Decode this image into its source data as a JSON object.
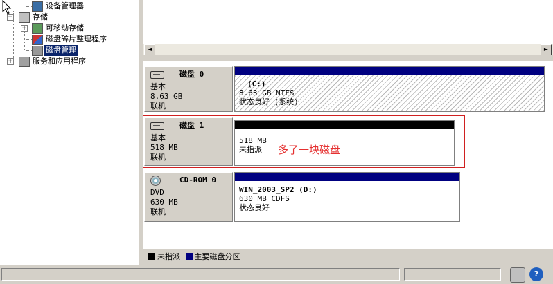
{
  "tree": {
    "items": [
      {
        "label": "设备管理器",
        "expander": ""
      },
      {
        "label": "存储",
        "expander": "−"
      },
      {
        "label": "可移动存储",
        "expander": "+"
      },
      {
        "label": "磁盘碎片整理程序",
        "expander": ""
      },
      {
        "label": "磁盘管理",
        "expander": ""
      },
      {
        "label": "服务和应用程序",
        "expander": "+"
      }
    ]
  },
  "scroll": {
    "left_arrow": "◄",
    "right_arrow": "►"
  },
  "disks": [
    {
      "name": "磁盘 0",
      "type": "基本",
      "size": "8.63 GB",
      "status": "联机",
      "partition": {
        "label": "(C:)",
        "detail": "8.63 GB NTFS",
        "state": "状态良好 (系统)"
      }
    },
    {
      "name": "磁盘 1",
      "type": "基本",
      "size": "518 MB",
      "status": "联机",
      "partition": {
        "label": "",
        "detail": "518 MB",
        "state": "未指派"
      }
    },
    {
      "name": "CD-ROM 0",
      "type": "DVD",
      "size": "630 MB",
      "status": "联机",
      "partition": {
        "label": "WIN_2003_SP2   (D:)",
        "detail": "630 MB CDFS",
        "state": "状态良好"
      }
    }
  ],
  "annotation": "多了一块磁盘",
  "legend": {
    "unallocated": "未指派",
    "primary": "主要磁盘分区",
    "colors": {
      "unallocated": "#000000",
      "primary": "#000080"
    }
  },
  "statusbar": {
    "help_icon": "?"
  }
}
